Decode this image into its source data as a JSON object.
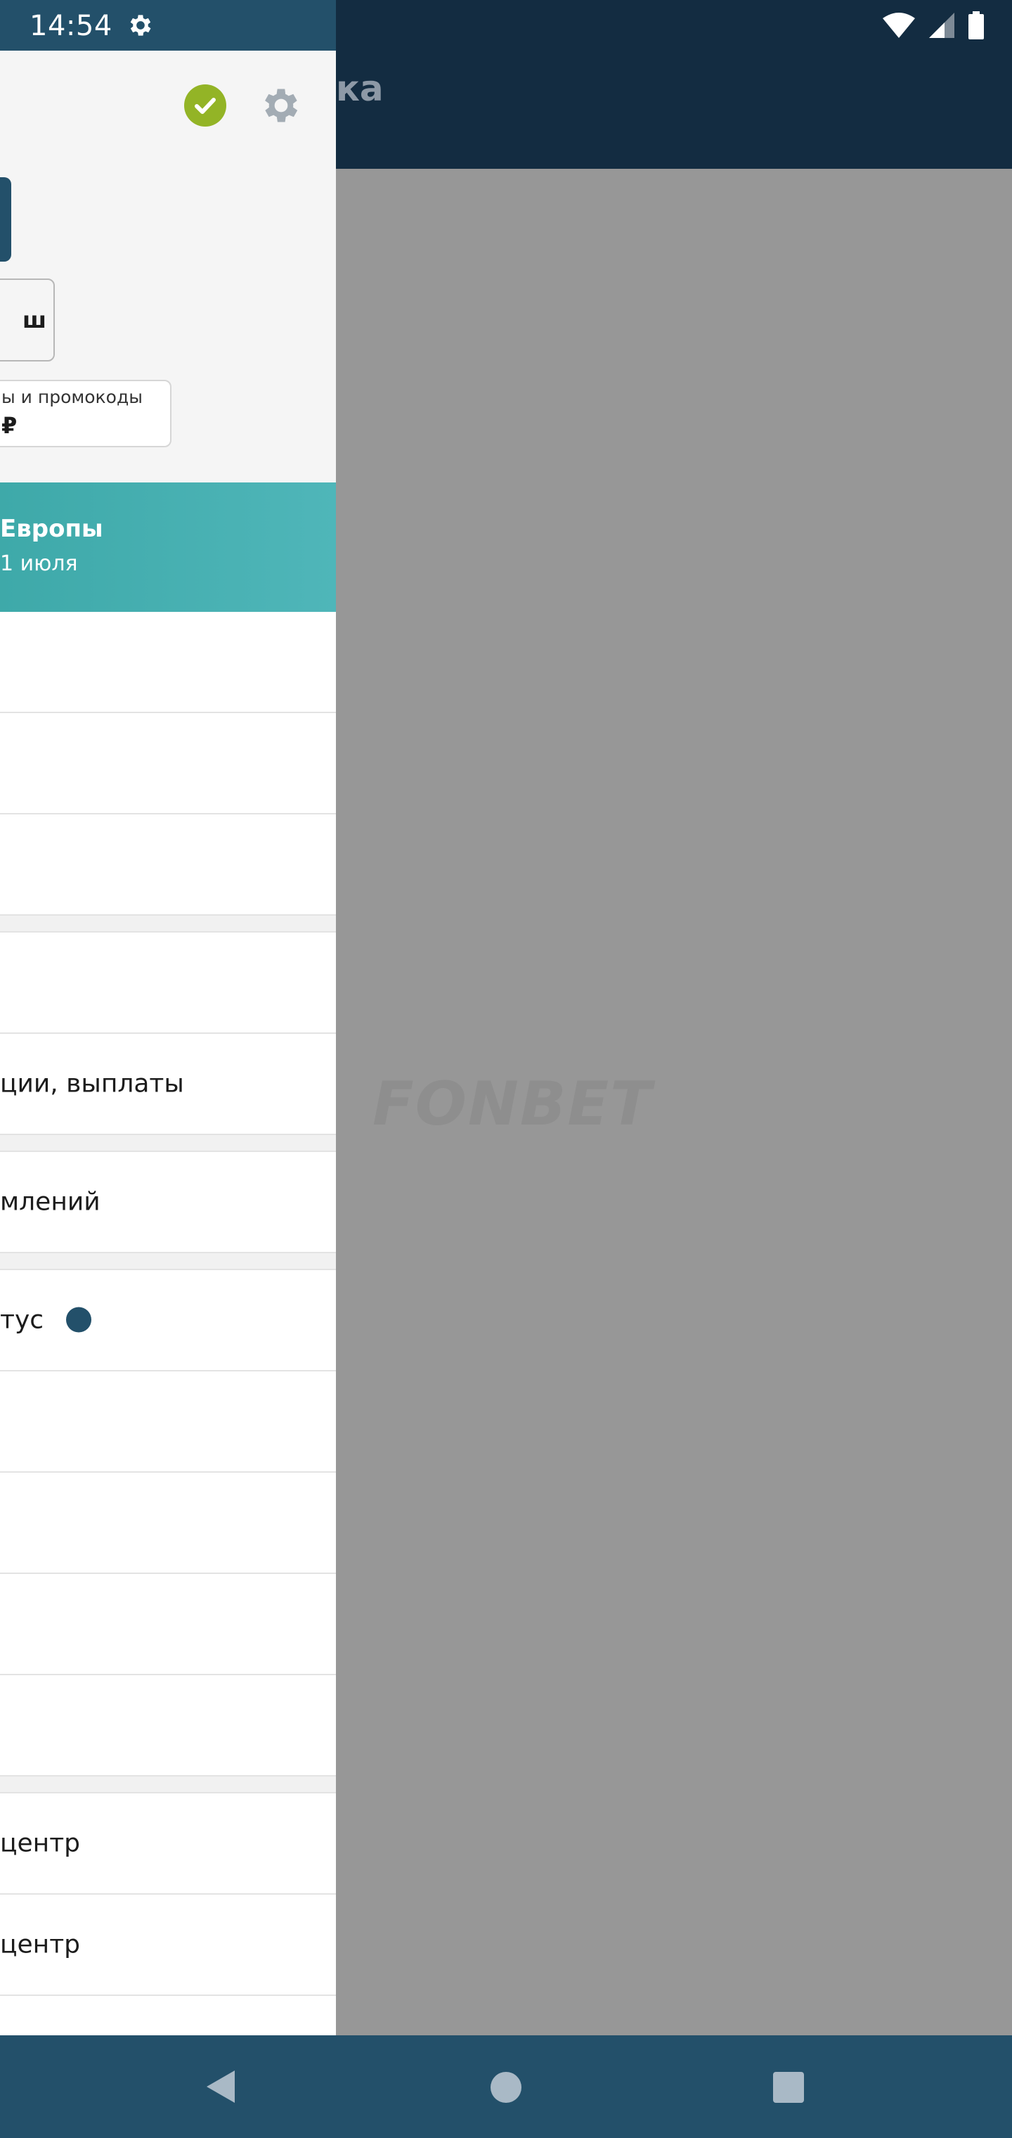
{
  "status_bar": {
    "time": "14:54",
    "icons": [
      "settings-icon",
      "wifi-icon",
      "signal-icon",
      "battery-icon"
    ]
  },
  "app_bar": {
    "title_fragment": "ка"
  },
  "background": {
    "watermark": "FONBET"
  },
  "drawer": {
    "header": {
      "status_icon": "check-circle-icon",
      "settings_icon": "gear-icon",
      "outline_button_label": "ш",
      "bonus_label": "ы и промокоды",
      "bonus_value": "₽"
    },
    "promo": {
      "title": "Европы",
      "subtitle": "1 июля"
    },
    "menu": {
      "items": [
        {
          "label": ""
        },
        {
          "label": ""
        },
        {
          "label": ""
        },
        {
          "label": ""
        },
        {
          "label": "ции, выплаты"
        },
        {
          "label": "млений"
        },
        {
          "label": "тус"
        },
        {
          "label": ""
        },
        {
          "label": ""
        },
        {
          "label": ""
        },
        {
          "label": ""
        },
        {
          "label": "центр"
        },
        {
          "label": " центр"
        },
        {
          "label": ""
        }
      ]
    }
  },
  "colors": {
    "status_bar": "#132c41",
    "drawer_status": "#23506a",
    "accent_green": "#93b426",
    "promo_teal": "#45b0b2",
    "nav_bar": "#23506a",
    "scrim": "#979797"
  },
  "nav_bar": {
    "icons": [
      "back-icon",
      "home-icon",
      "recent-apps-icon"
    ]
  }
}
